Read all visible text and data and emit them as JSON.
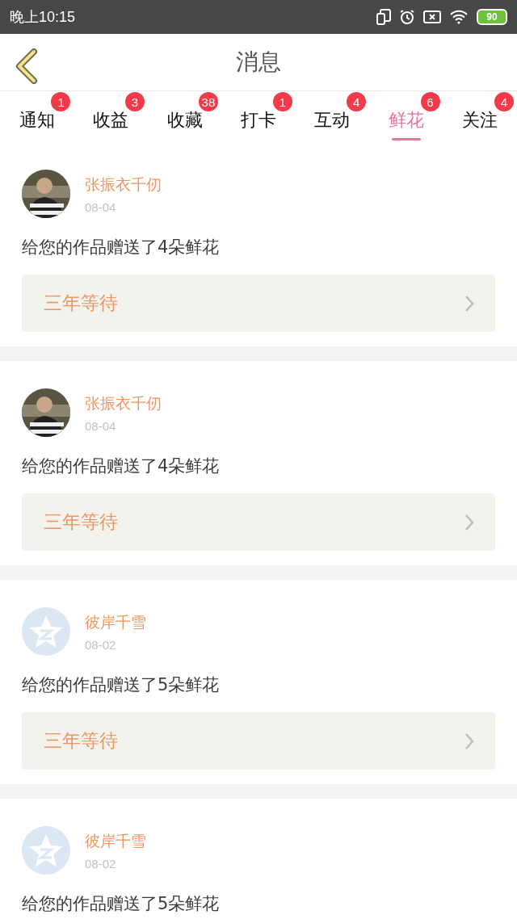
{
  "status_bar": {
    "time": "晚上10:15",
    "battery": "90"
  },
  "header": {
    "title": "消息"
  },
  "tabs": [
    {
      "label": "通知",
      "badge": "1",
      "selected": false
    },
    {
      "label": "收益",
      "badge": "3",
      "selected": false
    },
    {
      "label": "收藏",
      "badge": "38",
      "selected": false
    },
    {
      "label": "打卡",
      "badge": "1",
      "selected": false
    },
    {
      "label": "互动",
      "badge": "4",
      "selected": false
    },
    {
      "label": "鲜花",
      "badge": "6",
      "selected": true
    },
    {
      "label": "关注",
      "badge": "4",
      "selected": false
    }
  ],
  "messages": [
    {
      "name": "张振衣千仞",
      "date": "08-04",
      "text": "给您的作品赠送了4朵鲜花",
      "link": "三年等待"
    },
    {
      "name": "张振衣千仞",
      "date": "08-04",
      "text": "给您的作品赠送了4朵鲜花",
      "link": "三年等待"
    },
    {
      "avatar": {
        "kind": "default"
      },
      "name": "彼岸千雪",
      "date": "08-02",
      "text": "给您的作品赠送了5朵鲜花",
      "link": "三年等待"
    },
    {
      "avatar": {
        "kind": "default"
      },
      "name": "彼岸千雪",
      "date": "08-02",
      "text": "给您的作品赠送了5朵鲜花"
    }
  ]
}
